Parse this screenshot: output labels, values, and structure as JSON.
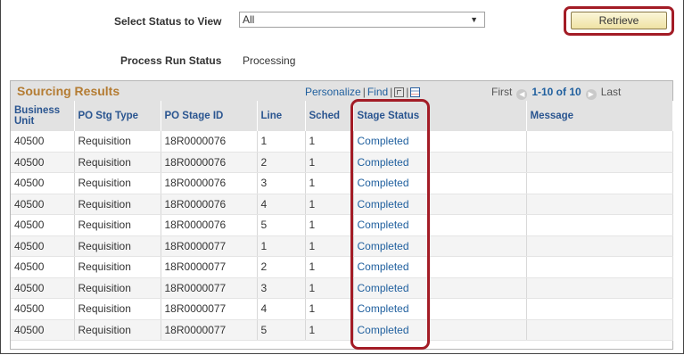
{
  "filter": {
    "label": "Select Status to View",
    "selected": "All"
  },
  "retrieve_label": "Retrieve",
  "run_status": {
    "label": "Process Run Status",
    "value": "Processing"
  },
  "grid": {
    "title": "Sourcing Results",
    "personalize": "Personalize",
    "find": "Find",
    "first": "First",
    "range": "1-10 of 10",
    "last": "Last",
    "columns": [
      "Business Unit",
      "PO Stg Type",
      "PO Stage ID",
      "Line",
      "Sched",
      "Stage Status",
      "Message"
    ],
    "rows": [
      [
        "40500",
        "Requisition",
        "18R0000076",
        "1",
        "1",
        "Completed",
        ""
      ],
      [
        "40500",
        "Requisition",
        "18R0000076",
        "2",
        "1",
        "Completed",
        ""
      ],
      [
        "40500",
        "Requisition",
        "18R0000076",
        "3",
        "1",
        "Completed",
        ""
      ],
      [
        "40500",
        "Requisition",
        "18R0000076",
        "4",
        "1",
        "Completed",
        ""
      ],
      [
        "40500",
        "Requisition",
        "18R0000076",
        "5",
        "1",
        "Completed",
        ""
      ],
      [
        "40500",
        "Requisition",
        "18R0000077",
        "1",
        "1",
        "Completed",
        ""
      ],
      [
        "40500",
        "Requisition",
        "18R0000077",
        "2",
        "1",
        "Completed",
        ""
      ],
      [
        "40500",
        "Requisition",
        "18R0000077",
        "3",
        "1",
        "Completed",
        ""
      ],
      [
        "40500",
        "Requisition",
        "18R0000077",
        "4",
        "1",
        "Completed",
        ""
      ],
      [
        "40500",
        "Requisition",
        "18R0000077",
        "5",
        "1",
        "Completed",
        ""
      ]
    ]
  },
  "colors": {
    "title": "#b47c33",
    "link": "#1f5f9e",
    "highlight": "#a31c26"
  }
}
